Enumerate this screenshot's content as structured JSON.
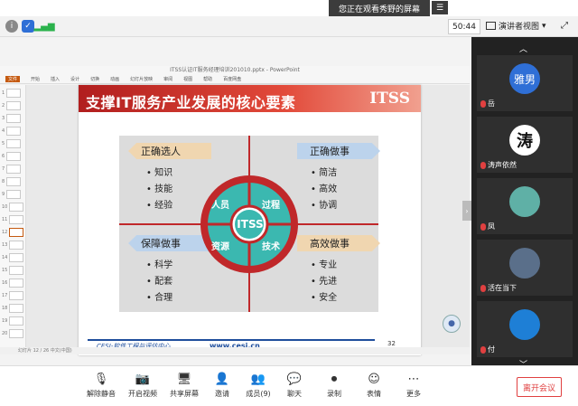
{
  "notice": {
    "text": "您正在观看秀野的屏幕",
    "button": "☰"
  },
  "meeting": {
    "timer": "50:44",
    "view_label": "演讲者视图",
    "view_chevron": "▾",
    "fullscreen_icon": "⤢"
  },
  "ppt": {
    "window_title": "ITSS认证IT服务经理培训201010.pptx - PowerPoint",
    "menu": [
      "文件",
      "开始",
      "插入",
      "设计",
      "切换",
      "动画",
      "幻灯片放映",
      "审阅",
      "视图",
      "帮助",
      "百度网盘"
    ],
    "slide_numbers": [
      "1",
      "2",
      "3",
      "4",
      "5",
      "6",
      "7",
      "8",
      "9",
      "10",
      "11",
      "12",
      "13",
      "14",
      "15",
      "16",
      "17",
      "18",
      "19",
      "20"
    ],
    "status": "幻灯片 12 / 26    中文(中国)"
  },
  "slide": {
    "title": "支撑IT服务产业发展的核心要素",
    "logo": "ITSS",
    "center": "ITSS",
    "ring": {
      "top_left": "人员",
      "top_right": "过程",
      "bottom_left": "资源",
      "bottom_right": "技术"
    },
    "quadrants": {
      "top_left": {
        "label": "正确选人",
        "items": [
          "知识",
          "技能",
          "经验"
        ]
      },
      "top_right": {
        "label": "正确做事",
        "items": [
          "简洁",
          "高效",
          "协调"
        ]
      },
      "bottom_left": {
        "label": "保障做事",
        "items": [
          "科学",
          "配套",
          "合理"
        ]
      },
      "bottom_right": {
        "label": "高效做事",
        "items": [
          "专业",
          "先进",
          "安全"
        ]
      }
    },
    "footer_org": "CESI-软件工程与评估中心",
    "footer_url": "www.cesi.cn",
    "page_number": "32"
  },
  "participants": [
    {
      "name": "岳",
      "avatar_text": "雅男",
      "color": "#2f6fd6"
    },
    {
      "name": "涛声依然",
      "avatar_text": "涛",
      "color": "#111111"
    },
    {
      "name": "凤",
      "avatar_text": "",
      "color": "#5fb0a6"
    },
    {
      "name": "活在当下",
      "avatar_text": "",
      "color": "#5a6f8a"
    },
    {
      "name": "付",
      "avatar_text": "",
      "color": "#1e7fd6"
    }
  ],
  "toolbar": {
    "unmute": "解除静音",
    "video": "开启视频",
    "share": "共享屏幕",
    "invite": "邀请",
    "members": "成员(9)",
    "chat": "聊天",
    "record": "录制",
    "reactions": "表情",
    "more": "更多",
    "leave": "离开会议"
  },
  "colors": {
    "accent": "#c0282a",
    "teal": "#3bb8b0",
    "label_tan": "#f0d6b0",
    "label_blue": "#bcd3ec",
    "leave": "#e04040"
  }
}
